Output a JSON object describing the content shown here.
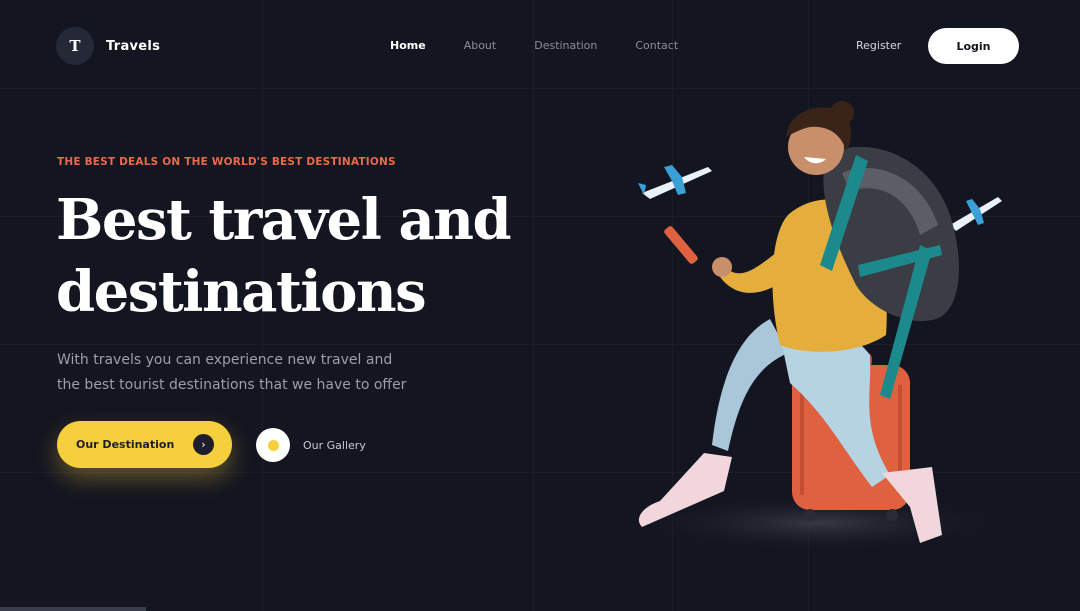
{
  "brand": {
    "logo_letter": "T",
    "name": "Travels"
  },
  "nav": {
    "items": [
      {
        "label": "Home",
        "active": true
      },
      {
        "label": "About",
        "active": false
      },
      {
        "label": "Destination",
        "active": false
      },
      {
        "label": "Contact",
        "active": false
      }
    ],
    "register_label": "Register",
    "login_label": "Login"
  },
  "hero": {
    "eyebrow": "THE BEST DEALS ON THE WORLD'S BEST DESTINATIONS",
    "headline_line1": "Best travel and",
    "headline_line2": "destinations",
    "subtitle_line1": "With travels you can experience new travel and",
    "subtitle_line2": "the best tourist destinations that we have to offer",
    "primary_cta": {
      "label": "Our Destination",
      "icon": "arrow-right-icon"
    },
    "secondary_cta": {
      "label": "Our Gallery",
      "icon": "play-icon"
    }
  },
  "colors": {
    "background": "#131520",
    "accent_yellow": "#f5cf3c",
    "eyebrow_orange": "#e86a4a",
    "plane_blue": "#3aa0d8"
  }
}
